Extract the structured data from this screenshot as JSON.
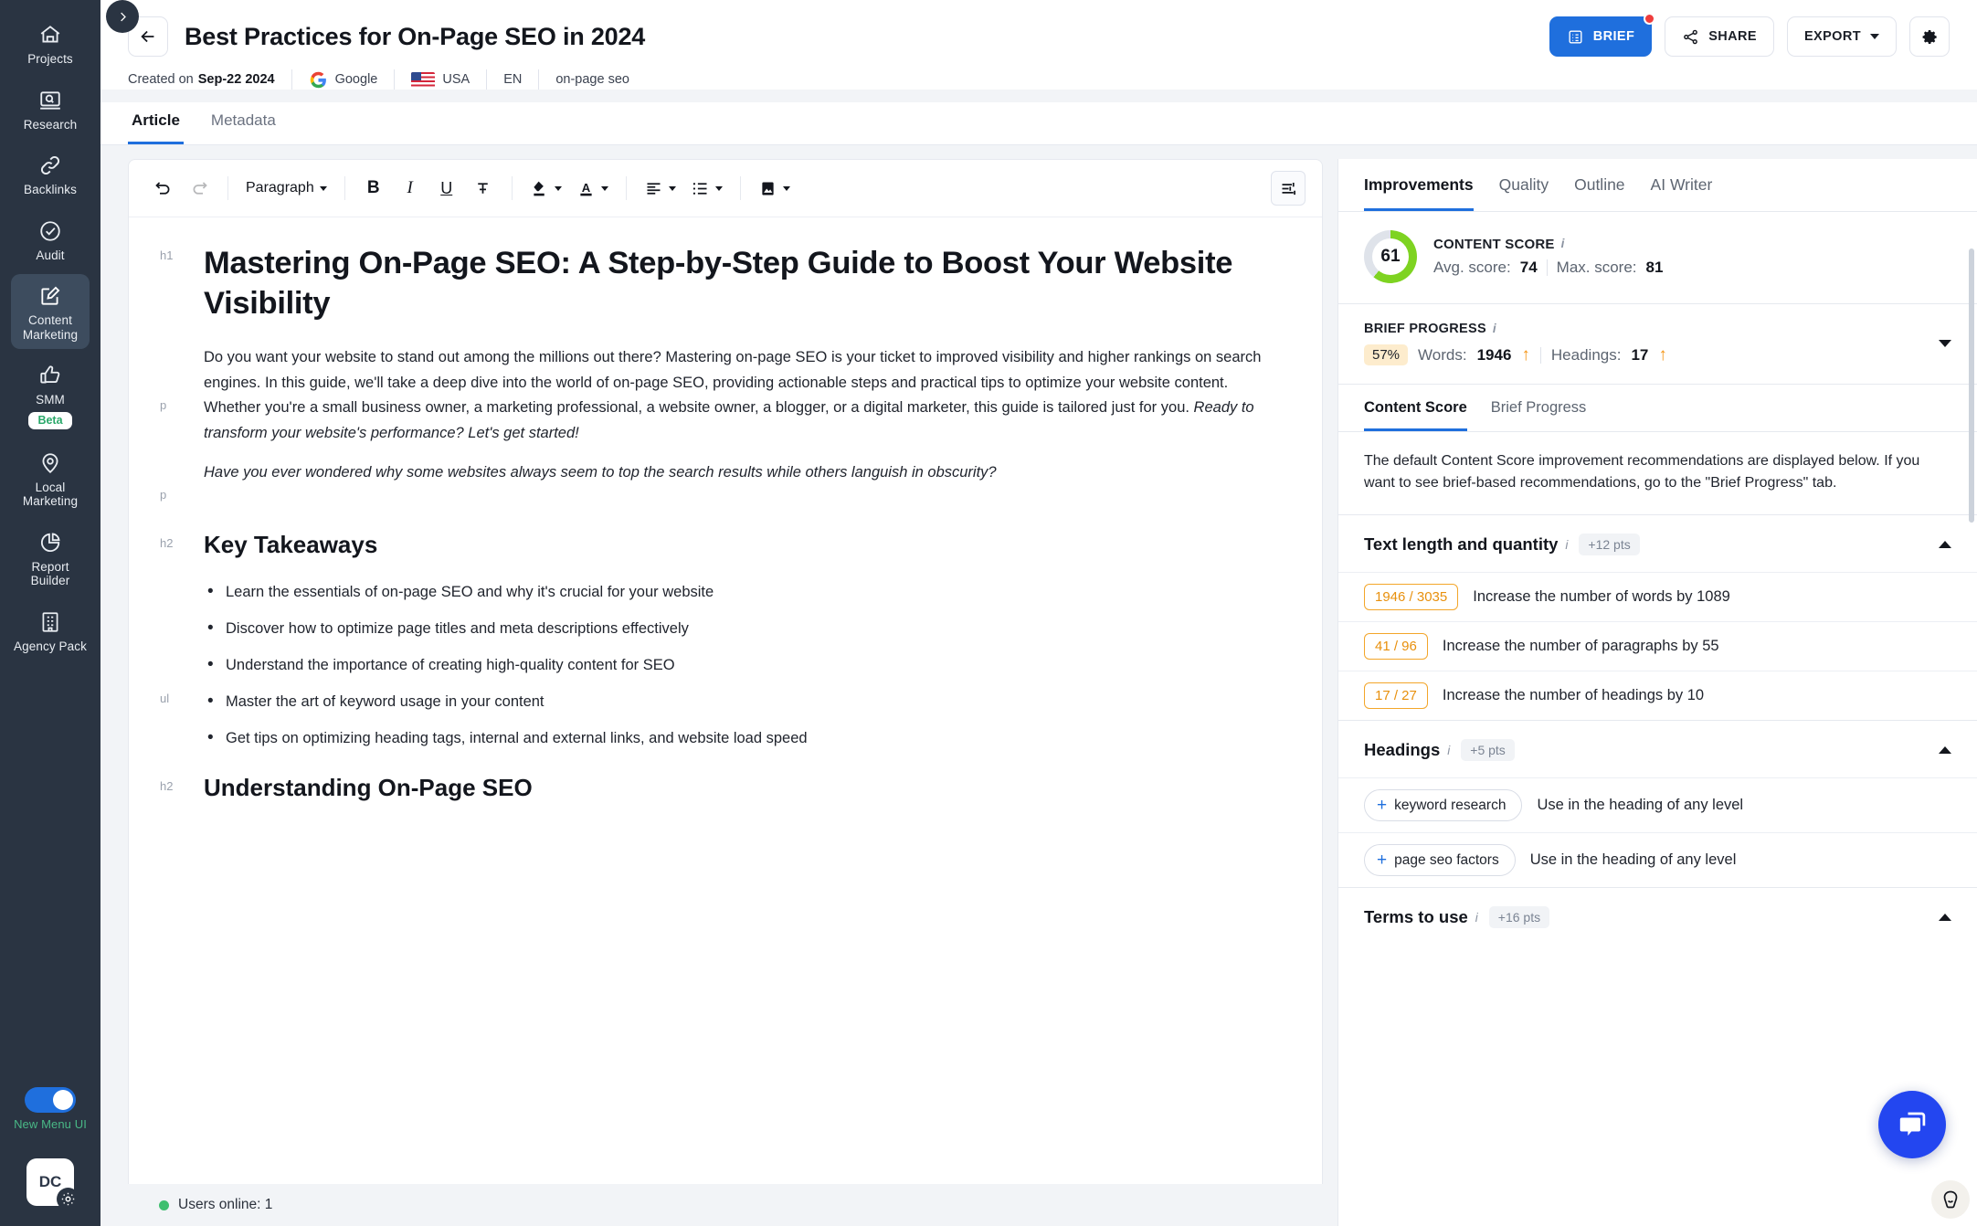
{
  "sidebar": {
    "items": [
      {
        "label": "Projects",
        "icon": "home-icon",
        "active": false
      },
      {
        "label": "Research",
        "icon": "research-icon",
        "active": false
      },
      {
        "label": "Backlinks",
        "icon": "link-icon",
        "active": false
      },
      {
        "label": "Audit",
        "icon": "check-circle-icon",
        "active": false
      },
      {
        "label": "Content Marketing",
        "icon": "edit-document-icon",
        "active": true
      },
      {
        "label": "SMM",
        "icon": "thumbs-up-icon",
        "active": false,
        "badge": "Beta"
      },
      {
        "label": "Local Marketing",
        "icon": "map-pin-icon",
        "active": false
      },
      {
        "label": "Report Builder",
        "icon": "pie-chart-icon",
        "active": false
      },
      {
        "label": "Agency Pack",
        "icon": "building-icon",
        "active": false
      }
    ],
    "toggle_label": "New Menu UI",
    "avatar_initials": "DC",
    "collapse_icon": "chevron-right-icon"
  },
  "header": {
    "back_icon": "arrow-left-icon",
    "title": "Best Practices for On-Page SEO in 2024",
    "meta": {
      "created_prefix": "Created on",
      "created_date": "Sep-22 2024",
      "search_engine": "Google",
      "country": "USA",
      "language": "EN",
      "keyword": "on-page seo"
    },
    "actions": {
      "brief_label": "BRIEF",
      "share_label": "SHARE",
      "export_label": "EXPORT",
      "settings_icon": "gear-icon"
    }
  },
  "doc_tabs": [
    {
      "label": "Article",
      "active": true
    },
    {
      "label": "Metadata",
      "active": false
    }
  ],
  "editor_toolbar": {
    "undo": "undo-icon",
    "redo": "redo-icon",
    "style_label": "Paragraph",
    "bold": "B",
    "italic": "I",
    "underline": "U",
    "strikethrough": "strikethrough-icon",
    "highlight": "highlight-color-icon",
    "text_color": "text-color-icon",
    "align": "align-left-icon",
    "list": "bullet-list-icon",
    "image": "image-icon",
    "settings": "editor-settings-icon"
  },
  "document": {
    "blocks": [
      {
        "tag": "h1",
        "type": "h1",
        "text": "Mastering On-Page SEO: A Step-by-Step Guide to Boost Your Website Visibility"
      },
      {
        "tag": "p",
        "type": "p",
        "text": "Do you want your website to stand out among the millions out there? Mastering on-page SEO is your ticket to improved visibility and higher rankings on search engines. In this guide, we'll take a deep dive into the world of on-page SEO, providing actionable steps and practical tips to optimize your website content. Whether you're a small business owner, a marketing professional, a website owner, a blogger, or a digital marketer, this guide is tailored just for you. ",
        "italic_tail": "Ready to transform your website's performance? Let's get started!"
      },
      {
        "tag": "p",
        "type": "p-italic",
        "text": "Have you ever wondered why some websites always seem to top the search results while others languish in obscurity?"
      },
      {
        "tag": "h2",
        "type": "h2",
        "text": "Key Takeaways"
      },
      {
        "tag": "ul",
        "type": "ul",
        "items": [
          "Learn the essentials of on-page SEO and why it's crucial for your website",
          "Discover how to optimize page titles and meta descriptions effectively",
          "Understand the importance of creating high-quality content for SEO",
          "Master the art of keyword usage in your content",
          "Get tips on optimizing heading tags, internal and external links, and website load speed"
        ]
      },
      {
        "tag": "h2",
        "type": "h2",
        "text": "Understanding On-Page SEO"
      }
    ]
  },
  "statusbar": {
    "users_online": "Users online: 1"
  },
  "right_panel": {
    "tabs": [
      {
        "label": "Improvements",
        "active": true
      },
      {
        "label": "Quality",
        "active": false
      },
      {
        "label": "Outline",
        "active": false
      },
      {
        "label": "AI Writer",
        "active": false
      }
    ],
    "content_score": {
      "caption": "CONTENT SCORE",
      "value": "61",
      "percent": 61,
      "avg_label": "Avg. score:",
      "avg_value": "74",
      "max_label": "Max. score:",
      "max_value": "81",
      "ring_color": "#7ed321"
    },
    "brief_progress": {
      "caption": "BRIEF PROGRESS",
      "percent_chip": "57%",
      "words_label": "Words:",
      "words_value": "1946",
      "headings_label": "Headings:",
      "headings_value": "17",
      "arrow_color": "#f59412"
    },
    "sub_tabs": [
      {
        "label": "Content Score",
        "active": true
      },
      {
        "label": "Brief Progress",
        "active": false
      }
    ],
    "note": "The default Content Score improvement recommendations are displayed below. If you want to see brief-based recommendations, go to the \"Brief Progress\" tab.",
    "sections": [
      {
        "title": "Text length and quantity",
        "pts": "+12 pts",
        "rows": [
          {
            "badge": "1946 / 3035",
            "text": "Increase the number of words by 1089"
          },
          {
            "badge": "41 / 96",
            "text": "Increase the number of paragraphs by 55"
          },
          {
            "badge": "17 / 27",
            "text": "Increase the number of headings by 10"
          }
        ]
      },
      {
        "title": "Headings",
        "pts": "+5 pts",
        "rows": [
          {
            "chip": "keyword research",
            "text": "Use in the heading of any level"
          },
          {
            "chip": "page seo factors",
            "text": "Use in the heading of any level"
          }
        ]
      },
      {
        "title": "Terms to use",
        "pts": "+16 pts",
        "rows": []
      }
    ],
    "chat_icon": "chat-bubble-icon",
    "mini_icon": "assistant-face-icon"
  }
}
